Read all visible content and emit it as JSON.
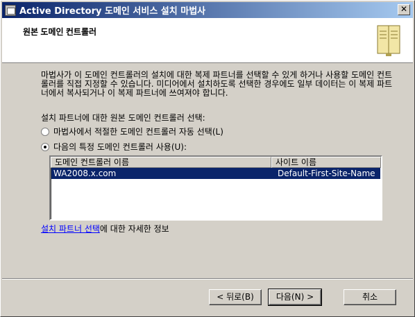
{
  "window": {
    "title": "Active Directory 도메인 서비스 설치 마법사",
    "close_label": "✕"
  },
  "header": {
    "title": "원본 도메인 컨트롤러",
    "icon": "book-icon"
  },
  "body": {
    "description": "마법사가 이 도메인 컨트롤러의 설치에 대한 복제 파트너를 선택할 수 있게 하거나 사용할 도메인 컨트롤러를 직접 지정할 수 있습니다. 미디어에서 설치하도록 선택한 경우에도 일부 데이터는 이 복제 파트너에서 복사되거나 이 복제 파트너에 쓰여져야 합니다.",
    "prompt": "설치 파트너에 대한 원본 도메인 컨트롤러 선택:",
    "options": [
      {
        "label": "마법사에서 적절한 도메인 컨트롤러 자동 선택(L)",
        "checked": false
      },
      {
        "label": "다음의 특정 도메인 컨트롤러 사용(U):",
        "checked": true
      }
    ],
    "table": {
      "columns": [
        "도메인 컨트롤러 이름",
        "사이트 이름"
      ],
      "rows": [
        {
          "name": "WA2008.x.com",
          "site": "Default-First-Site-Name",
          "selected": true
        }
      ]
    },
    "link_text": "설치 파트너 선택",
    "link_suffix": "에 대한 자세한 정보"
  },
  "footer": {
    "back_label": "< 뒤로(B)",
    "next_label": "다음(N) >",
    "cancel_label": "취소"
  },
  "colors": {
    "title_bar": "#0a246a",
    "selection": "#0a246a",
    "link": "#0000ff"
  }
}
